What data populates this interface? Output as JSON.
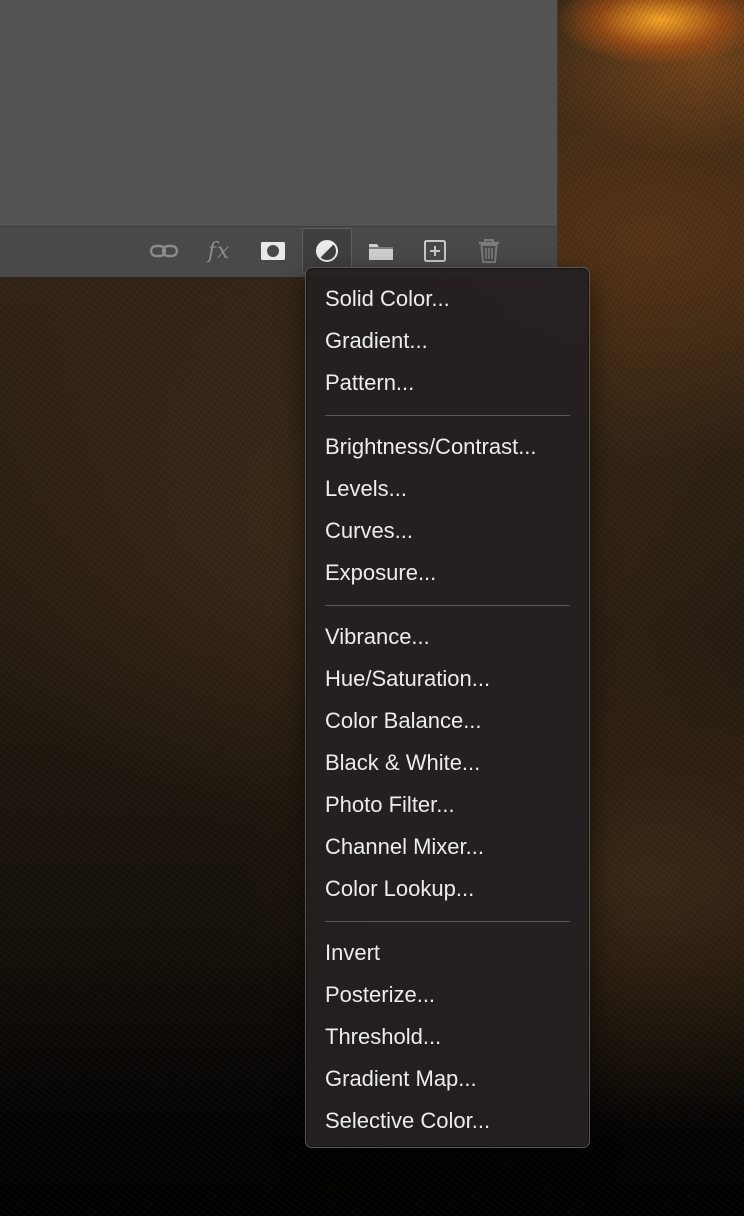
{
  "layers_panel": {
    "footer_buttons": [
      {
        "icon": "link-icon"
      },
      {
        "icon": "fx-icon",
        "label": "fx"
      },
      {
        "icon": "layer-mask-icon"
      },
      {
        "icon": "adjustment-layer-icon",
        "active": true
      },
      {
        "icon": "folder-icon"
      },
      {
        "icon": "new-layer-icon"
      },
      {
        "icon": "trash-icon"
      }
    ]
  },
  "adjustment_menu": {
    "groups": [
      [
        "Solid Color...",
        "Gradient...",
        "Pattern..."
      ],
      [
        "Brightness/Contrast...",
        "Levels...",
        "Curves...",
        "Exposure..."
      ],
      [
        "Vibrance...",
        "Hue/Saturation...",
        "Color Balance...",
        "Black & White...",
        "Photo Filter...",
        "Channel Mixer...",
        "Color Lookup..."
      ],
      [
        "Invert",
        "Posterize...",
        "Threshold...",
        "Gradient Map...",
        "Selective Color..."
      ]
    ]
  },
  "colors": {
    "panel_bg": "#535353",
    "footer_bg": "#494949",
    "menu_bg": "#242020",
    "menu_text": "#ececec"
  }
}
